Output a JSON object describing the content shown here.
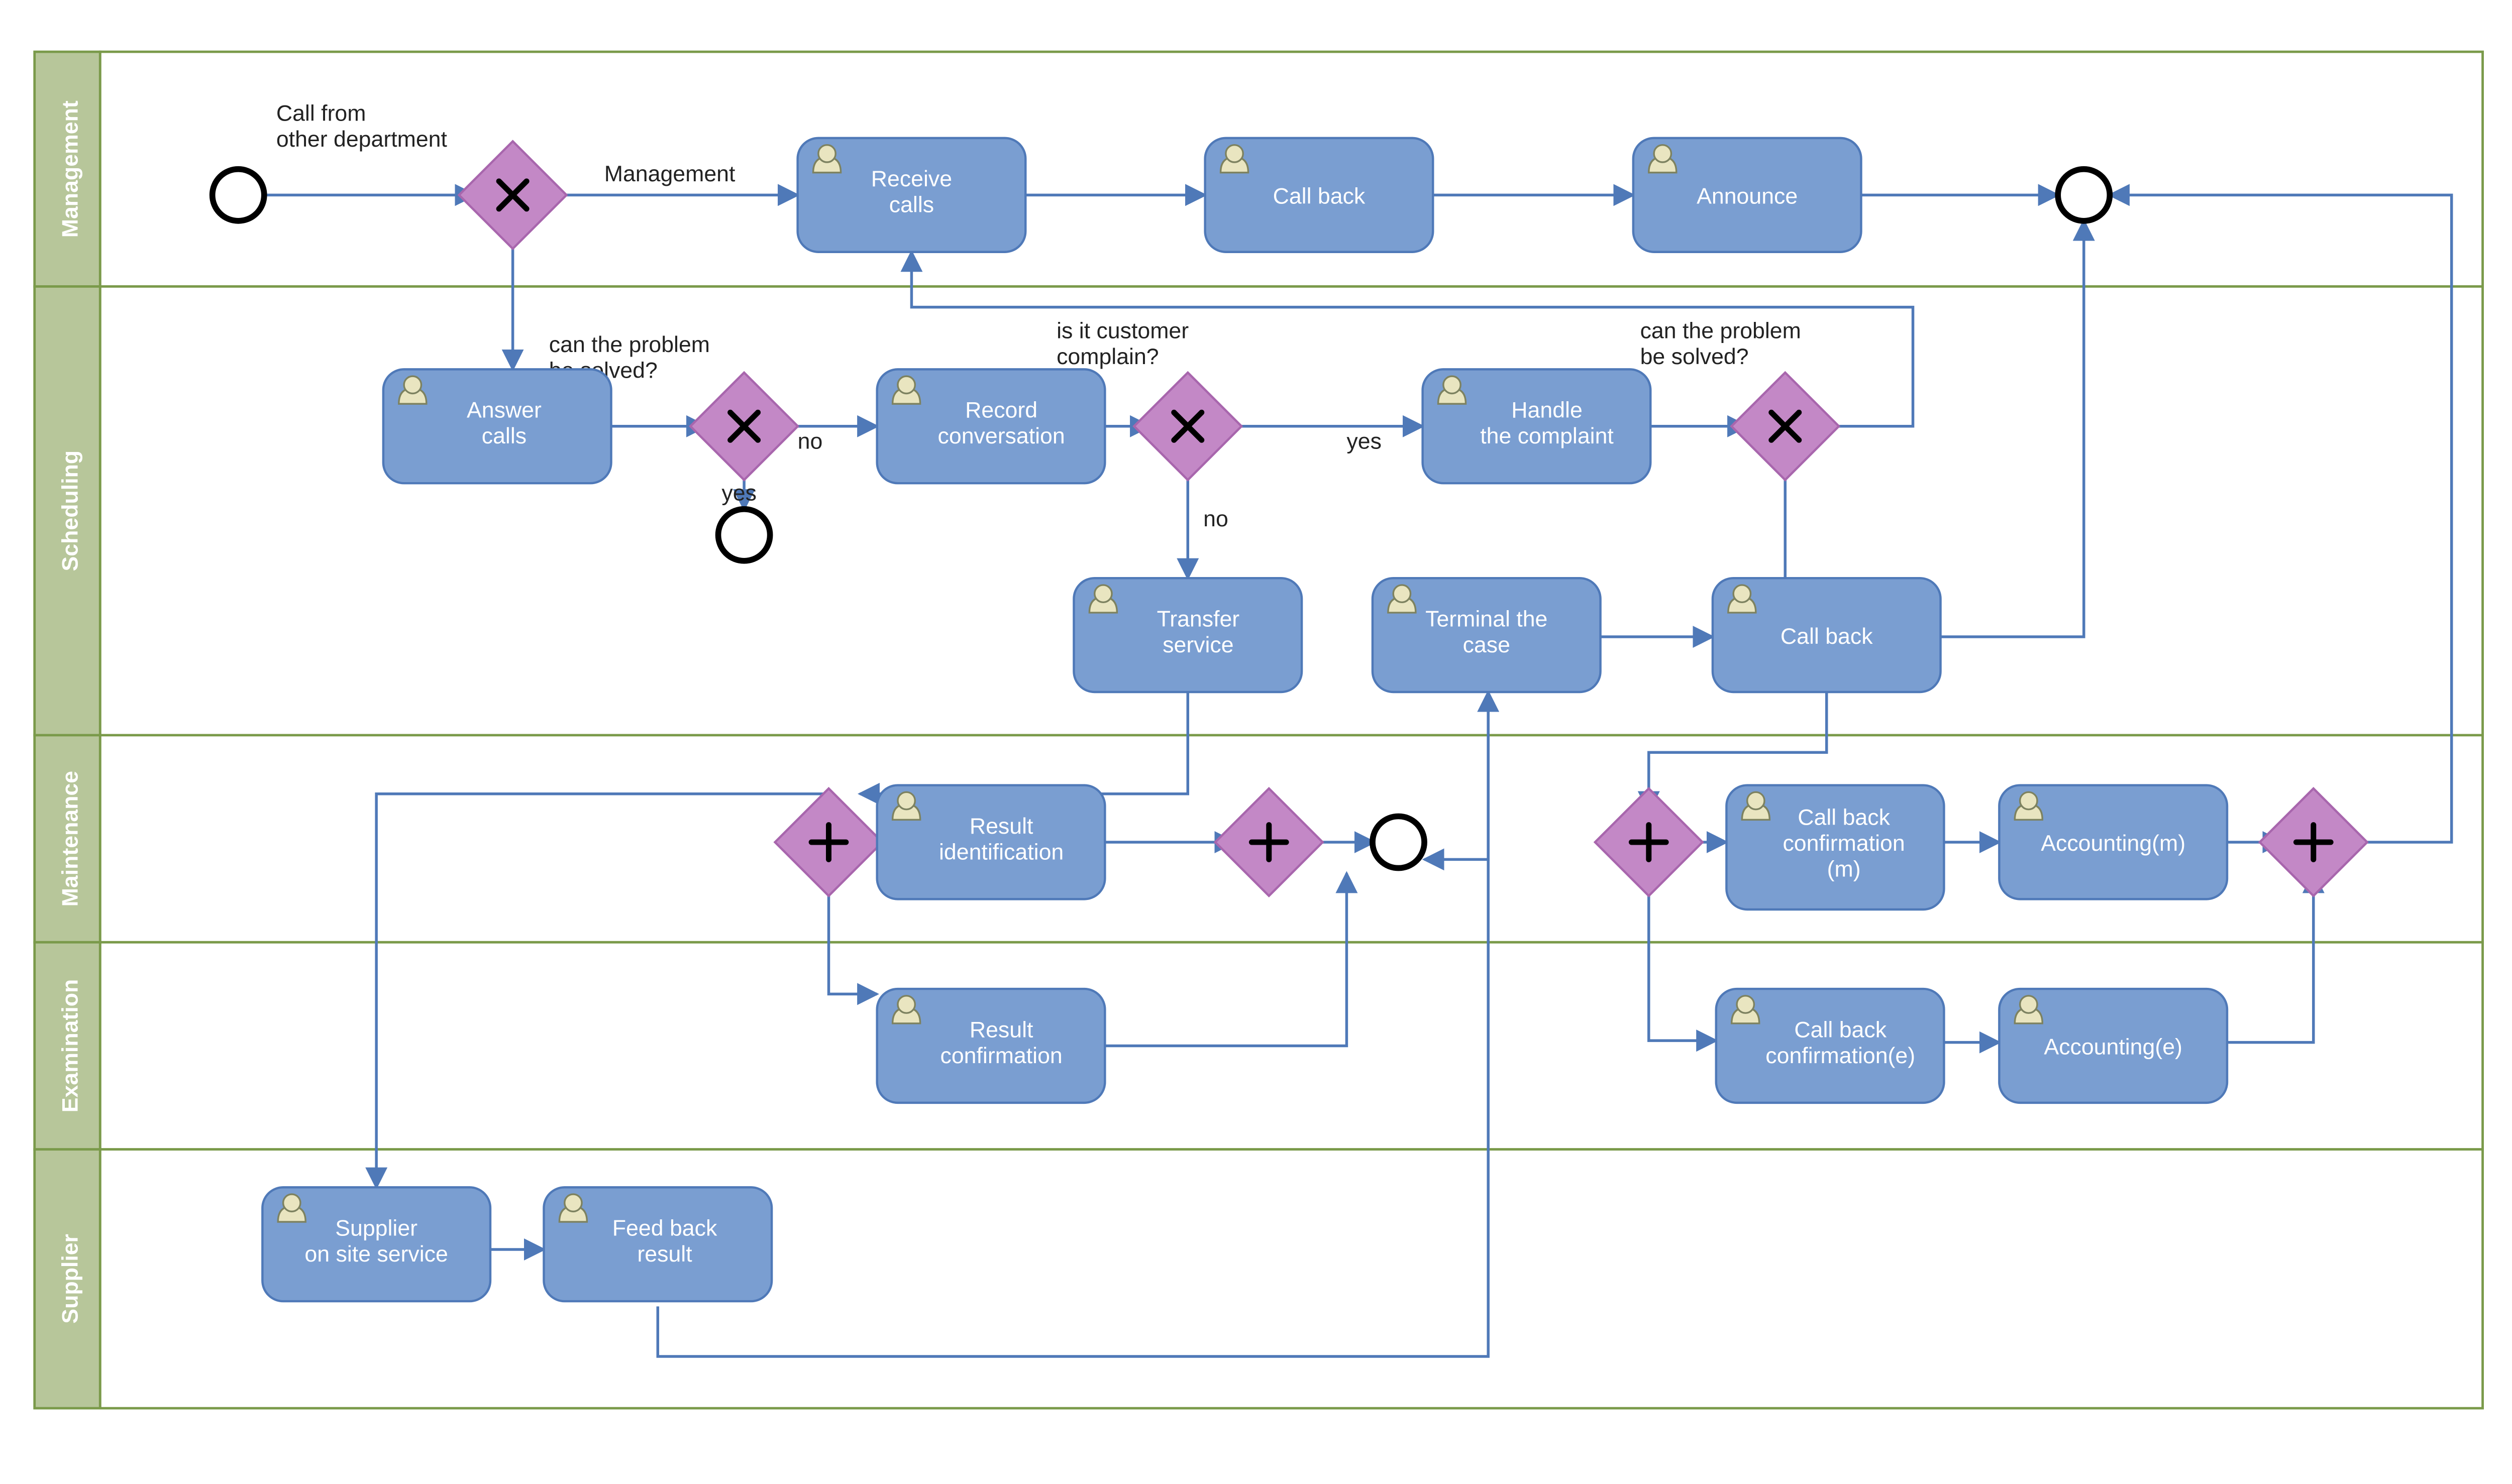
{
  "lanes": {
    "management": "Management",
    "scheduling": "Scheduling",
    "maintenance": "Maintenance",
    "examination": "Examination",
    "supplier": "Supplier"
  },
  "tasks": {
    "receive_calls": "Receive\ncalls",
    "call_back_mgmt": "Call back",
    "announce": "Announce",
    "answer_calls": "Answer\ncalls",
    "record_conversation": "Record\nconversation",
    "handle_complaint": "Handle\nthe complaint",
    "transfer_service": "Transfer\nservice",
    "terminal_case": "Terminal the\ncase",
    "call_back_sched": "Call back",
    "result_identification": "Result\nidentification",
    "call_back_conf_m": "Call back\nconfirmation\n(m)",
    "accounting_m": "Accounting(m)",
    "result_confirmation": "Result\nconfirmation",
    "call_back_conf_e": "Call back\nconfirmation(e)",
    "accounting_e": "Accounting(e)",
    "supplier_on_site": "Supplier\non site service",
    "feed_back_result": "Feed back\nresult"
  },
  "labels": {
    "call_from": "Call from\nother department",
    "management_branch": "Management",
    "can_solve_1": "can the problem\nbe solved?",
    "yes_1": "yes",
    "no_1": "no",
    "is_complain": "is it customer\ncomplain?",
    "yes_2": "yes",
    "no_2": "no",
    "can_solve_2": "can the problem\nbe solved?"
  }
}
